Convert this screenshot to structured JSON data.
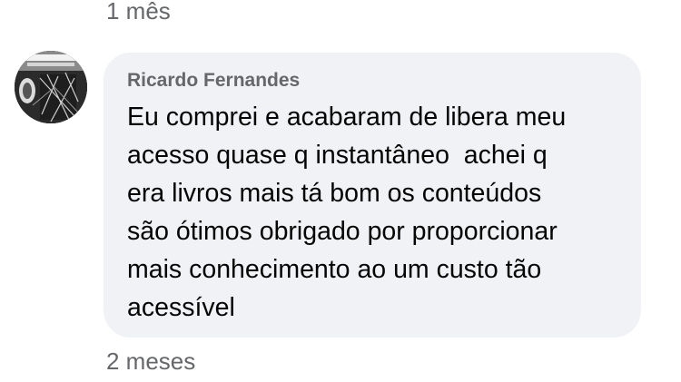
{
  "previous_comment": {
    "timestamp": "1 mês"
  },
  "comment": {
    "author": "Ricardo Fernandes",
    "text_lines": [
      "Eu comprei e acabaram de libera meu",
      "acesso quase q instantâneo  achei q",
      "era livros mais tá bom os conteúdos",
      "são ótimos obrigado por proporcionar",
      "mais conhecimento ao um custo tão",
      "acessível"
    ],
    "timestamp": "2 meses"
  },
  "colors": {
    "bubble_background": "#f0f2f5",
    "secondary_text": "#65676b",
    "primary_text": "#050505"
  }
}
